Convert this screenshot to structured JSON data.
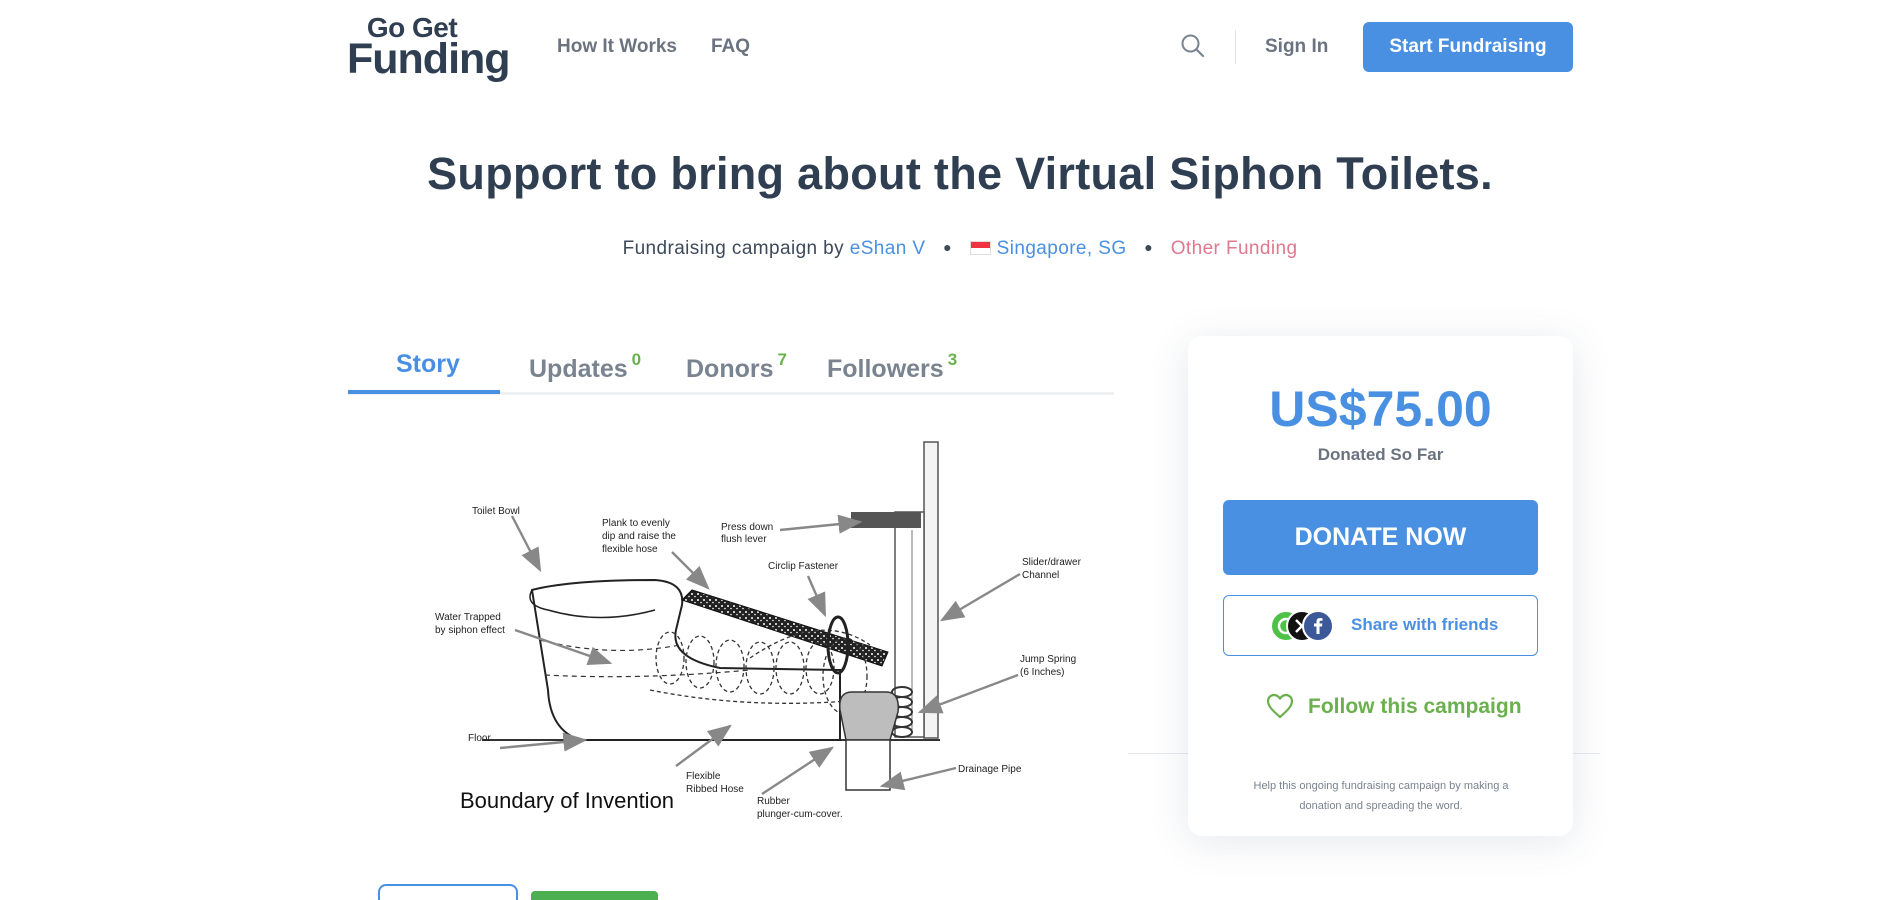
{
  "header": {
    "logo_line1": "Go Get",
    "logo_line2": "Funding",
    "nav": {
      "how_it_works": "How It Works",
      "faq": "FAQ"
    },
    "sign_in": "Sign In",
    "start_fundraising": "Start Fundraising"
  },
  "campaign": {
    "title": "Support to bring about the Virtual Siphon Toilets.",
    "by_prefix": "Fundraising campaign by",
    "organizer": "eShan V",
    "location": "Singapore, SG",
    "category": "Other Funding"
  },
  "tabs": [
    {
      "label": "Story",
      "count": ""
    },
    {
      "label": "Updates",
      "count": "0"
    },
    {
      "label": "Donors",
      "count": "7"
    },
    {
      "label": "Followers",
      "count": "3"
    }
  ],
  "diagram": {
    "labels": {
      "toilet_bowl": "Toilet Bowl",
      "plank": [
        "Plank to evenly",
        "dip and raise the",
        "flexible hose"
      ],
      "press_down": [
        "Press down",
        "flush lever"
      ],
      "circlip": "Circlip Fastener",
      "slider": [
        "Slider/drawer",
        "Channel"
      ],
      "water": [
        "Water Trapped",
        "by siphon effect"
      ],
      "jump_spring": [
        "Jump Spring",
        "(6 Inches)"
      ],
      "floor": "Floor",
      "drainage": "Drainage Pipe",
      "flexible_hose": [
        "Flexible",
        "Ribbed Hose"
      ],
      "rubber": [
        "Rubber",
        "plunger-cum-cover."
      ],
      "boundary": "Boundary of Invention"
    }
  },
  "donation": {
    "amount": "US$75.00",
    "amount_caption": "Donated So Far",
    "donate_label": "DONATE NOW",
    "share_label": "Share with friends",
    "follow_label": "Follow this campaign",
    "help_text": "Help this ongoing fundraising campaign by making a donation and spreading the word."
  },
  "colors": {
    "accent": "#4a90e2",
    "green": "#6ab04c",
    "category_pink": "#e0788e",
    "heading": "#2f3e51"
  },
  "icons": [
    "search-icon",
    "sg-flag-icon",
    "whatsapp-icon",
    "x-icon",
    "facebook-icon",
    "heart-icon"
  ]
}
